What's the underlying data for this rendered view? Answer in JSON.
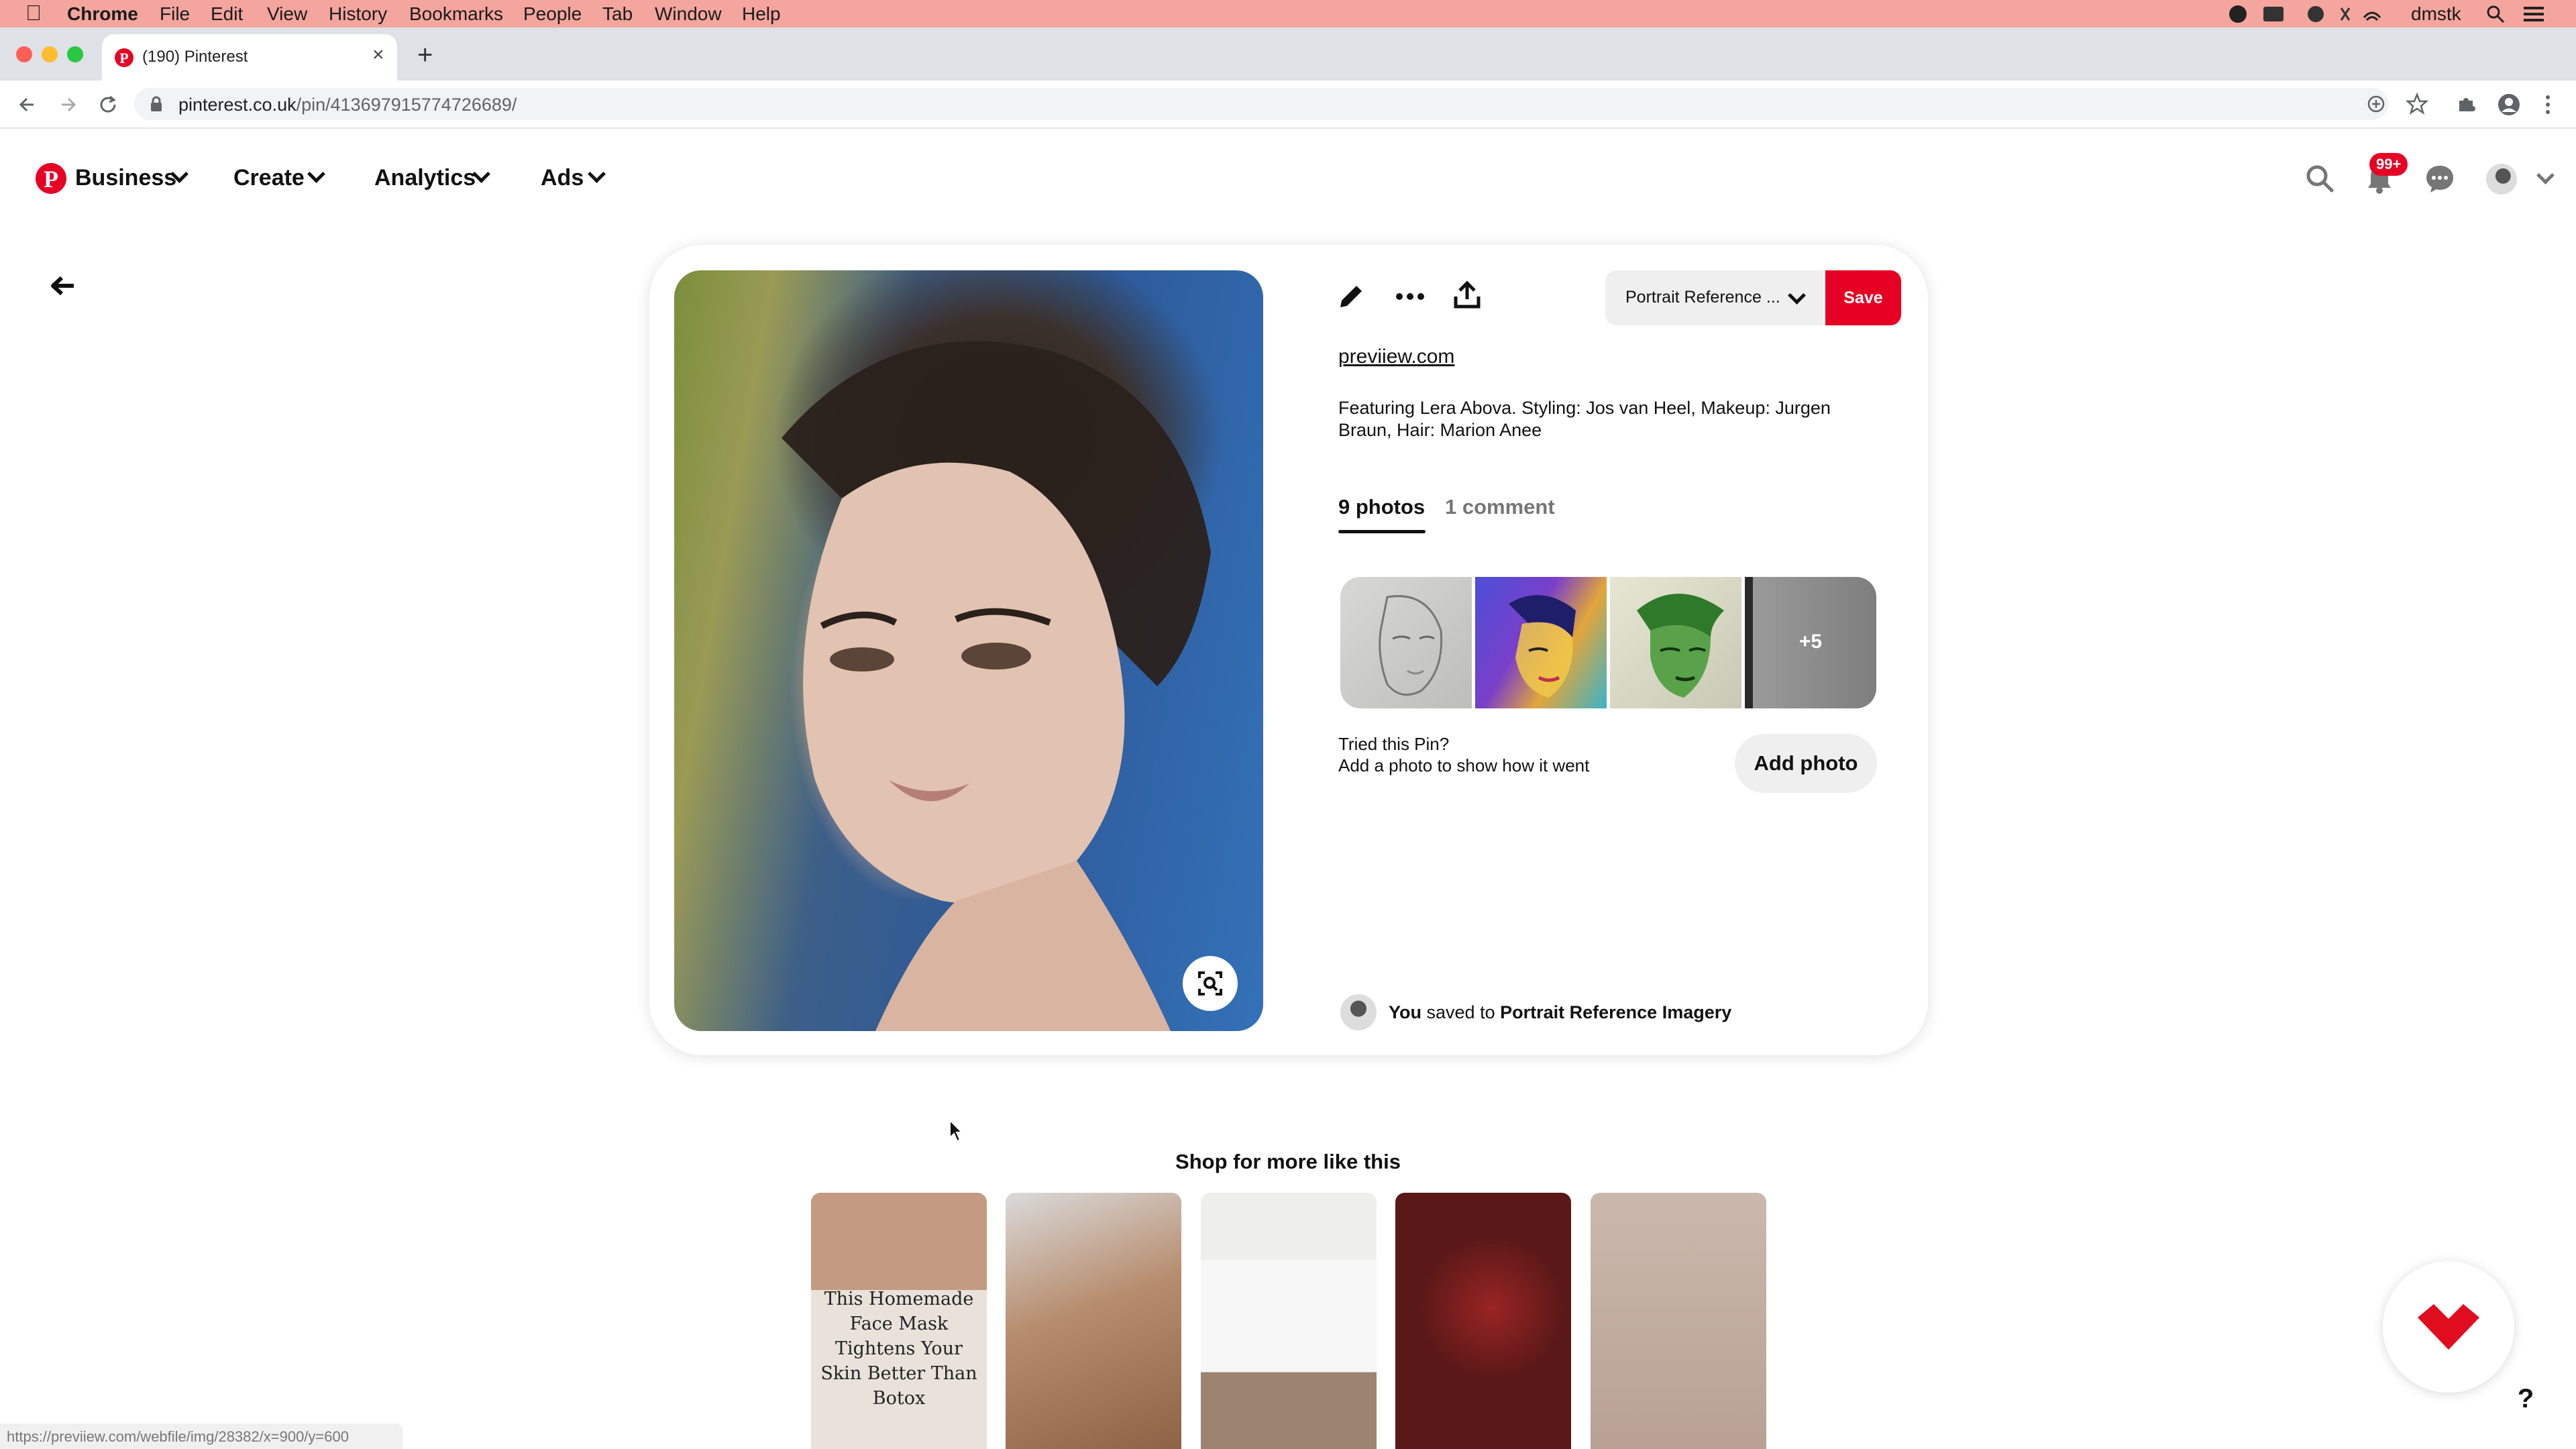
{
  "menubar": {
    "app": "Chrome",
    "items": [
      "File",
      "Edit",
      "View",
      "History",
      "Bookmarks",
      "People",
      "Tab",
      "Window",
      "Help"
    ],
    "user": "dmstk"
  },
  "browser": {
    "tab_title": "(190) Pinterest",
    "url_host": "pinterest.co.uk",
    "url_path": "/pin/413697915774726689/",
    "status_url": "https://previiew.com/webfile/img/28382/x=900/y=600"
  },
  "header": {
    "nav": [
      "Business",
      "Create",
      "Analytics",
      "Ads"
    ],
    "notifications_badge": "99+",
    "colors": {
      "brand": "#e60023"
    }
  },
  "pin": {
    "board_select": "Portrait Reference ...",
    "save_label": "Save",
    "source": "previiew.com",
    "description": "Featuring Lera Abova. Styling: Jos van Heel, Makeup: Jurgen Braun, Hair: Marion Anee",
    "tabs": {
      "photos": "9 photos",
      "comments": "1 comment"
    },
    "more_count": "+5",
    "tried_title": "Tried this Pin?",
    "tried_sub": "Add a photo to show how it went",
    "add_photo_label": "Add photo",
    "saved": {
      "who": "You",
      "verb": "saved to",
      "board": "Portrait Reference Imagery"
    }
  },
  "shop": {
    "title": "Shop for more like this",
    "first_item_text": "This Homemade Face Mask Tightens Your Skin Better Than Botox"
  },
  "help_label": "?"
}
